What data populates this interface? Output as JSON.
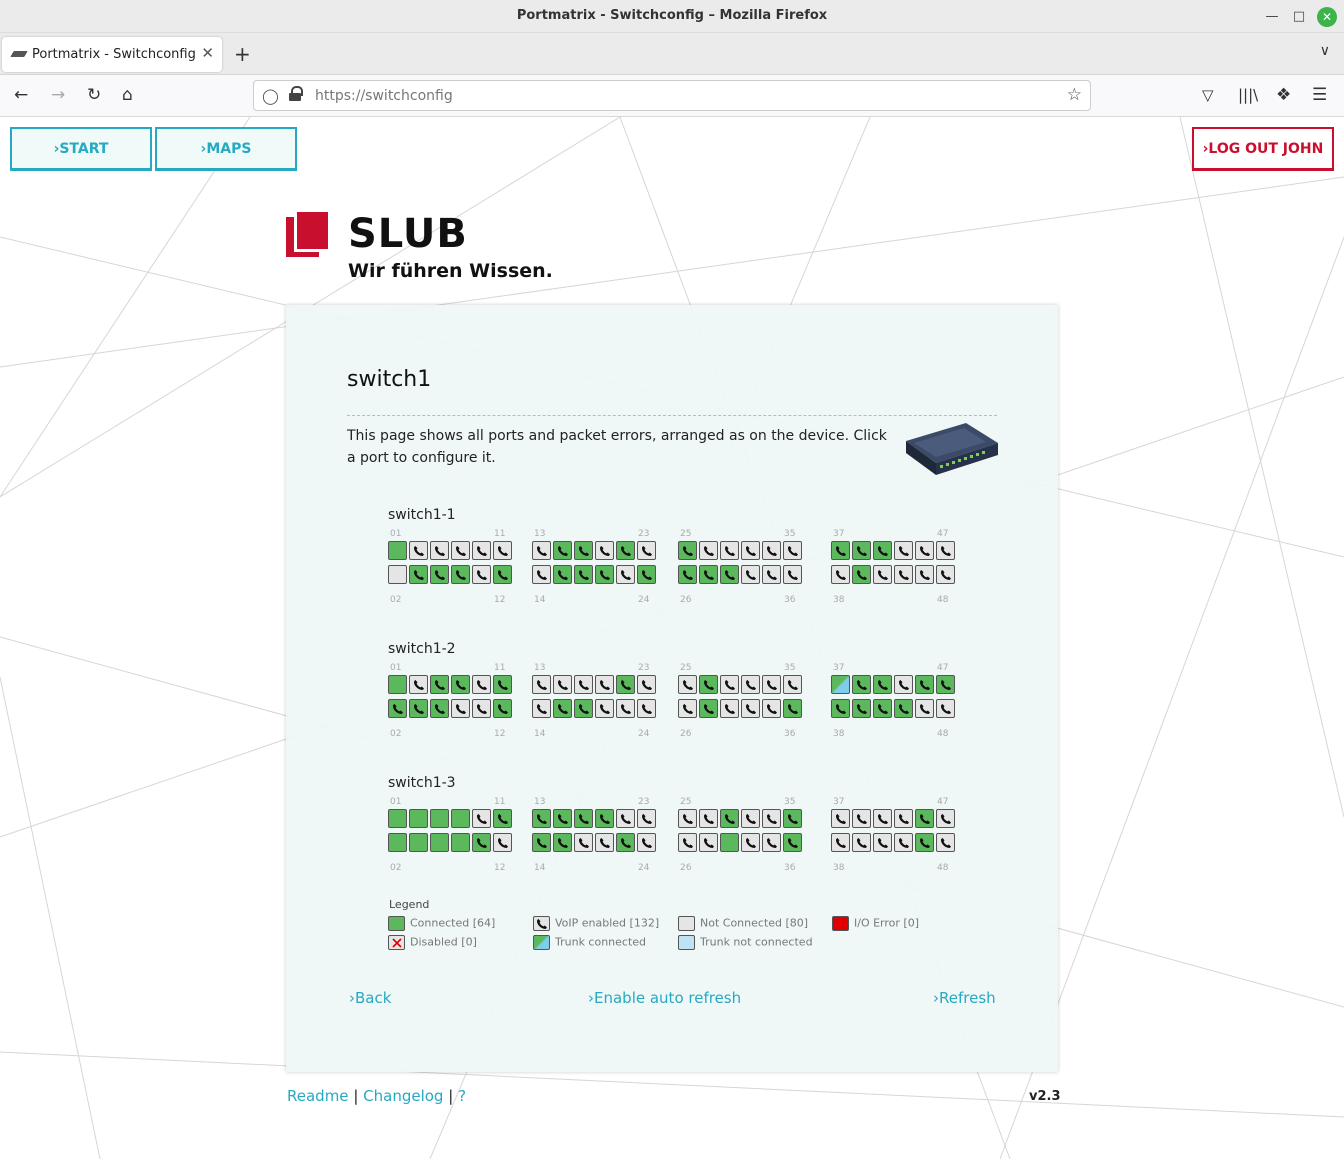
{
  "window": {
    "title": "Portmatrix - Switchconfig – Mozilla Firefox"
  },
  "tab": {
    "label": "Portmatrix - Switchconfig"
  },
  "address_bar": {
    "url": "https://switchconfig"
  },
  "nav": {
    "start": "›START",
    "maps": "›MAPS",
    "logout": "›LOG OUT JOHN"
  },
  "logo": {
    "name": "SLUB",
    "tagline": "Wir führen Wissen."
  },
  "page": {
    "heading": "switch1",
    "description": "This page shows all ports and packet errors, arranged as on the device. Click a port to configure it."
  },
  "switches": [
    {
      "name": "switch1-1",
      "top": [
        "g",
        "v",
        "v",
        "v",
        "v",
        "v",
        "v",
        "gv",
        "gv",
        "v",
        "gv",
        "v",
        "gv",
        "v",
        "v",
        "v",
        "v",
        "v",
        "gv",
        "gv",
        "gv",
        "v",
        "v",
        "v"
      ],
      "bottom": [
        "n",
        "gv",
        "gv",
        "gv",
        "v",
        "gv",
        "v",
        "gv",
        "gv",
        "gv",
        "v",
        "gv",
        "gv",
        "gv",
        "gv",
        "v",
        "v",
        "v",
        "v",
        "gv",
        "v",
        "v",
        "v",
        "v"
      ]
    },
    {
      "name": "switch1-2",
      "top": [
        "g",
        "v",
        "gv",
        "gv",
        "v",
        "gv",
        "v",
        "v",
        "v",
        "v",
        "gv",
        "v",
        "v",
        "gv",
        "v",
        "v",
        "v",
        "v",
        "t",
        "gv",
        "gv",
        "v",
        "gv",
        "gv"
      ],
      "bottom": [
        "gv",
        "gv",
        "gv",
        "v",
        "v",
        "gv",
        "v",
        "gv",
        "gv",
        "v",
        "v",
        "v",
        "v",
        "gv",
        "v",
        "v",
        "v",
        "gv",
        "gv",
        "gv",
        "gv",
        "gv",
        "v",
        "v"
      ]
    },
    {
      "name": "switch1-3",
      "top": [
        "g",
        "g",
        "g",
        "g",
        "v",
        "gv",
        "gv",
        "gv",
        "gv",
        "gv",
        "v",
        "v",
        "v",
        "v",
        "gv",
        "v",
        "v",
        "gv",
        "v",
        "v",
        "v",
        "v",
        "gv",
        "v"
      ],
      "bottom": [
        "g",
        "g",
        "g",
        "g",
        "gv",
        "v",
        "gv",
        "gv",
        "v",
        "v",
        "gv",
        "v",
        "v",
        "v",
        "g",
        "v",
        "v",
        "gv",
        "v",
        "v",
        "v",
        "v",
        "gv",
        "v"
      ]
    }
  ],
  "port_numbers": {
    "top": [
      [
        "01",
        "11"
      ],
      [
        "13",
        "23"
      ],
      [
        "25",
        "35"
      ],
      [
        "37",
        "47"
      ]
    ],
    "bottom": [
      [
        "02",
        "12"
      ],
      [
        "14",
        "24"
      ],
      [
        "26",
        "36"
      ],
      [
        "38",
        "48"
      ]
    ]
  },
  "legend": {
    "title": "Legend",
    "connected": "Connected [64]",
    "voip": "VoIP enabled [132]",
    "not_connected": "Not Connected [80]",
    "io_error": "I/O Error [0]",
    "disabled": "Disabled [0]",
    "trunk_connected": "Trunk connected",
    "trunk_not_connected": "Trunk not connected"
  },
  "links": {
    "back": "›Back",
    "auto_refresh": "›Enable auto refresh",
    "refresh": "›Refresh"
  },
  "footer": {
    "readme": "Readme",
    "changelog": "Changelog",
    "help": "?",
    "sep": "|",
    "version": "v2.3"
  },
  "colors": {
    "accent": "#26a9c2",
    "brand": "#c8102e",
    "connected": "#5cb85c",
    "not_connected": "#e5e5e5",
    "io_error": "#e00000"
  }
}
